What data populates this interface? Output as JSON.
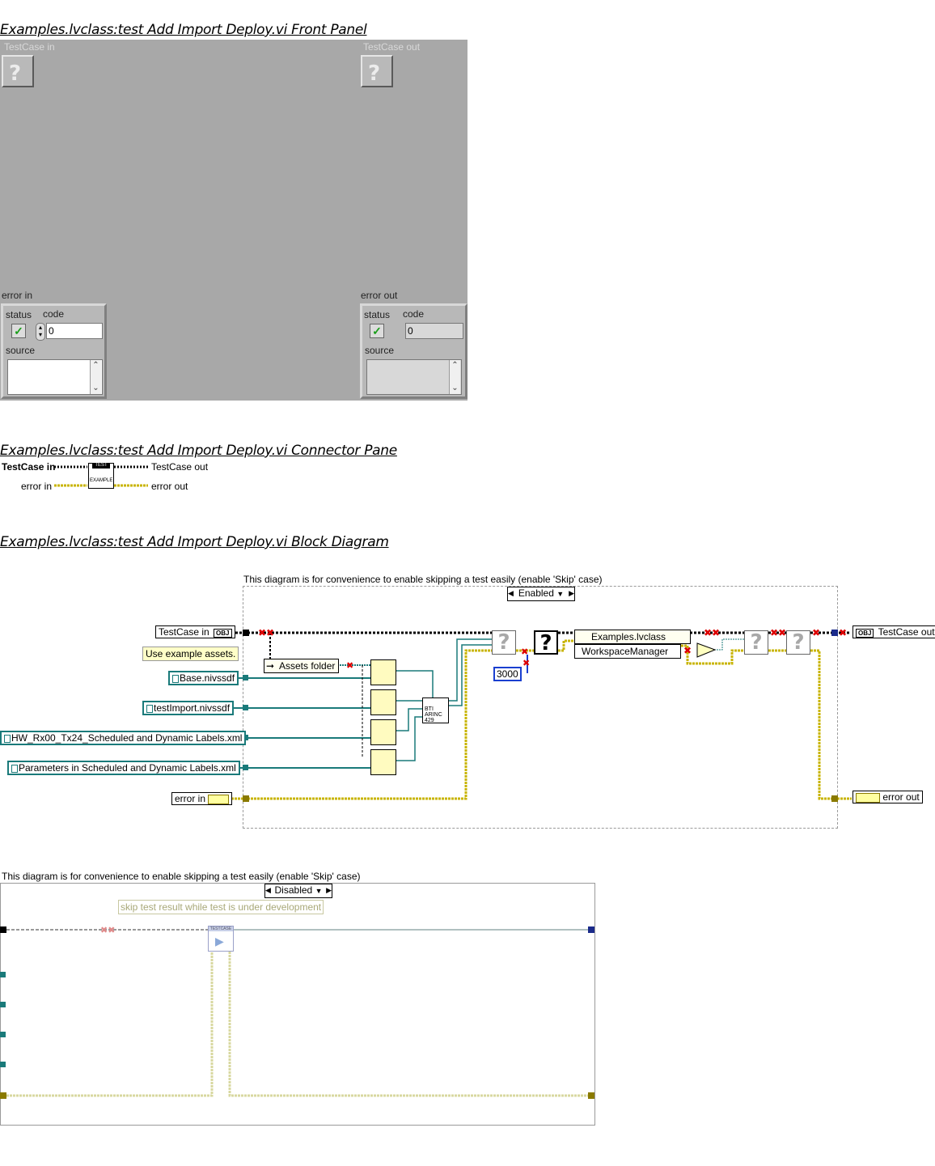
{
  "front_panel": {
    "title": "Examples.lvclass:test Add Import Deploy.vi Front Panel",
    "testcase_in_label": "TestCase in",
    "testcase_out_label": "TestCase out",
    "error_in": {
      "label": "error in",
      "status_label": "status",
      "code_label": "code",
      "code_value": "0",
      "source_label": "source",
      "source_value": ""
    },
    "error_out": {
      "label": "error out",
      "status_label": "status",
      "code_label": "code",
      "code_value": "0",
      "source_label": "source",
      "source_value": ""
    }
  },
  "connector_pane": {
    "title": "Examples.lvclass:test Add Import Deploy.vi Connector Pane",
    "testcase_in": "TestCase in",
    "testcase_out": "TestCase out",
    "error_in": "error in",
    "error_out": "error out",
    "icon_top": "TEST",
    "icon_bottom": "EXAMPLE"
  },
  "block_diagram": {
    "title": "Examples.lvclass:test Add Import Deploy.vi Block Diagram",
    "comment": "This diagram is for convenience to enable skipping a test easily (enable 'Skip' case)",
    "case_selector": "Enabled",
    "testcase_in": "TestCase in",
    "obj_glyph": "OBJ",
    "use_example_assets": "Use example assets.",
    "assets_folder": "Assets folder",
    "path_constants": [
      "Base.nivssdf",
      "testImport.nivssdf",
      "HW_Rx00_Tx24_Scheduled and Dynamic Labels.xml",
      "Parameters in Scheduled and Dynamic Labels.xml"
    ],
    "error_in": "error in",
    "error_out": "error out",
    "testcase_out": "TestCase out",
    "timeout_const": "3000",
    "class_node": "Examples.lvclass",
    "property": "WorkspaceManager",
    "arinc_icon": [
      "BTI",
      "ARINC",
      "429"
    ],
    "question_glyph": "?"
  },
  "disabled_case": {
    "comment": "This diagram is for convenience to enable skipping a test easily (enable 'Skip' case)",
    "case_selector": "Disabled",
    "note": "skip test result while test is under development",
    "icon_top": "TESTCASE"
  },
  "colors": {
    "front_panel_bg": "#a8a8a8",
    "error_wire": "#c8b400",
    "path_wire": "#1a7a7a",
    "class_wire": "#000000"
  }
}
